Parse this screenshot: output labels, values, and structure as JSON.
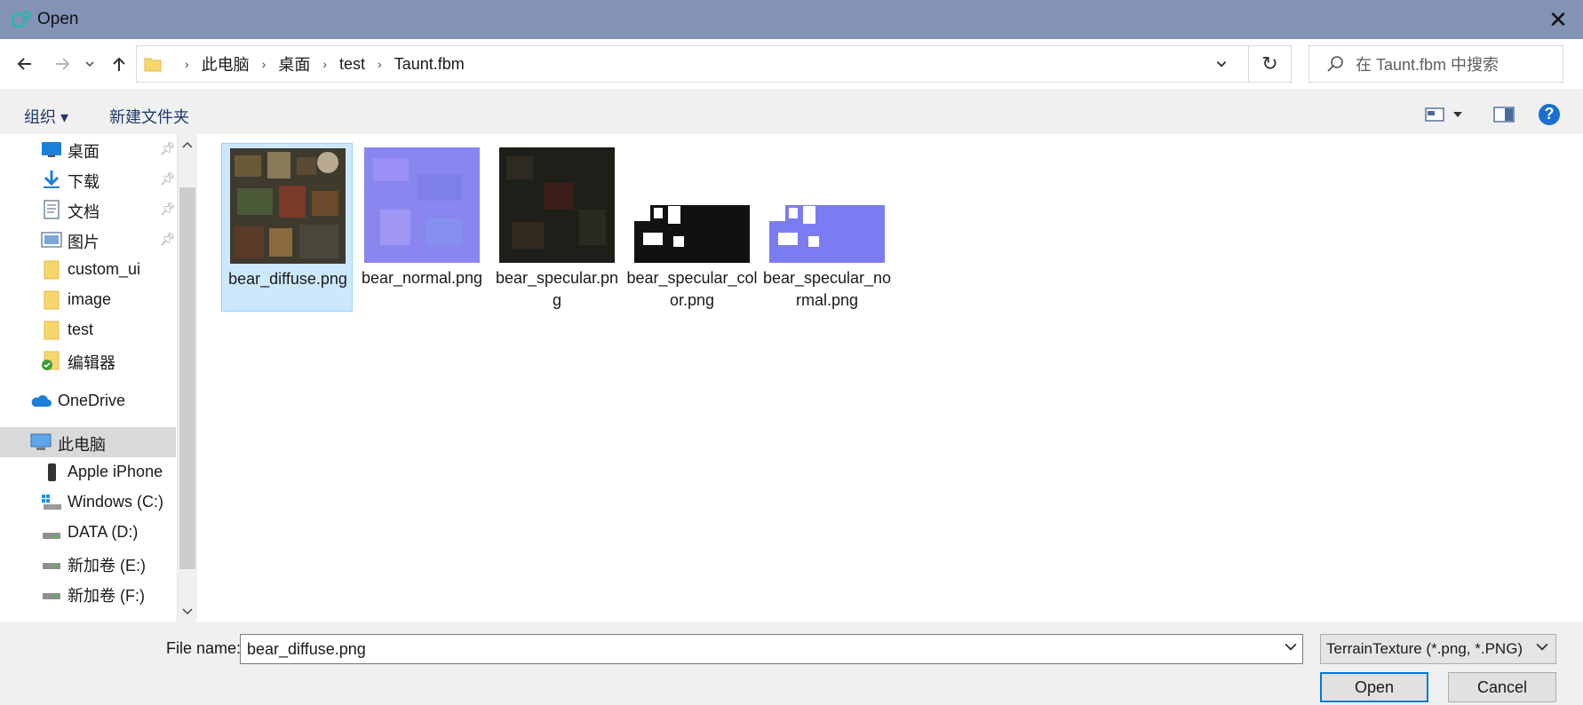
{
  "window": {
    "title": "Open",
    "close_glyph": "✕"
  },
  "nav": {
    "back_icon": "arrow-left-icon",
    "forward_icon": "arrow-right-icon",
    "recent_icon": "chevron-down-icon",
    "up_icon": "arrow-up-icon",
    "breadcrumb": [
      "此电脑",
      "桌面",
      "test",
      "Taunt.fbm"
    ],
    "refresh_glyph": "↻",
    "search_placeholder": "在 Taunt.fbm 中搜索"
  },
  "toolbar": {
    "organize": "组织 ▾",
    "new_folder": "新建文件夹",
    "help": "?"
  },
  "sidebar": {
    "items": [
      {
        "label": "桌面",
        "icon": "desktop-icon",
        "pinned": true
      },
      {
        "label": "下载",
        "icon": "download-icon",
        "pinned": true
      },
      {
        "label": "文档",
        "icon": "document-icon",
        "pinned": true
      },
      {
        "label": "图片",
        "icon": "picture-icon",
        "pinned": true
      },
      {
        "label": "custom_ui",
        "icon": "folder-icon",
        "pinned": false
      },
      {
        "label": "image",
        "icon": "folder-icon",
        "pinned": false
      },
      {
        "label": "test",
        "icon": "folder-icon",
        "pinned": false
      },
      {
        "label": "编辑器",
        "icon": "folder-check-icon",
        "pinned": false
      },
      {
        "label": "OneDrive",
        "icon": "cloud-icon",
        "pinned": false
      },
      {
        "label": "此电脑",
        "icon": "computer-icon",
        "pinned": false,
        "selected": true
      },
      {
        "label": "Apple iPhone",
        "icon": "phone-icon",
        "pinned": false
      },
      {
        "label": "Windows (C:)",
        "icon": "drive-windows-icon",
        "pinned": false
      },
      {
        "label": "DATA (D:)",
        "icon": "drive-icon",
        "pinned": false
      },
      {
        "label": "新加卷 (E:)",
        "icon": "drive-icon",
        "pinned": false
      },
      {
        "label": "新加卷 (F:)",
        "icon": "drive-icon",
        "pinned": false
      }
    ]
  },
  "files": [
    {
      "name": "bear_diffuse.png",
      "selected": true,
      "thumb": "diffuse"
    },
    {
      "name": "bear_normal.png",
      "selected": false,
      "thumb": "normal"
    },
    {
      "name": "bear_specular.png",
      "selected": false,
      "thumb": "specular"
    },
    {
      "name": "bear_specular_color.png",
      "selected": false,
      "thumb": "specular_color"
    },
    {
      "name": "bear_specular_normal.png",
      "selected": false,
      "thumb": "specular_normal"
    }
  ],
  "bottom": {
    "file_name_label": "File name:",
    "file_name_value": "bear_diffuse.png",
    "filter_value": "TerrainTexture (*.png, *.PNG)",
    "open_label": "Open",
    "cancel_label": "Cancel"
  },
  "colors": {
    "titlebar": "#8393b5",
    "selection": "#cce8ff",
    "accent": "#0078d7"
  }
}
